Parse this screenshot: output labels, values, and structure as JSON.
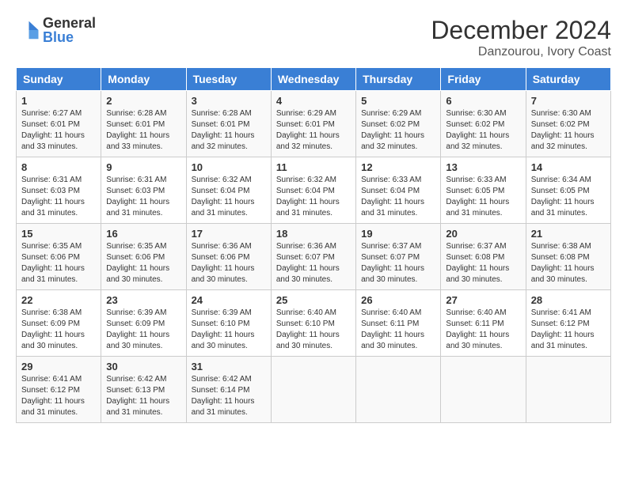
{
  "logo": {
    "general": "General",
    "blue": "Blue"
  },
  "title": "December 2024",
  "subtitle": "Danzourou, Ivory Coast",
  "days": [
    "Sunday",
    "Monday",
    "Tuesday",
    "Wednesday",
    "Thursday",
    "Friday",
    "Saturday"
  ],
  "weeks": [
    [
      {
        "day": "1",
        "sunrise": "6:27 AM",
        "sunset": "6:01 PM",
        "daylight": "11 hours and 33 minutes."
      },
      {
        "day": "2",
        "sunrise": "6:28 AM",
        "sunset": "6:01 PM",
        "daylight": "11 hours and 33 minutes."
      },
      {
        "day": "3",
        "sunrise": "6:28 AM",
        "sunset": "6:01 PM",
        "daylight": "11 hours and 32 minutes."
      },
      {
        "day": "4",
        "sunrise": "6:29 AM",
        "sunset": "6:01 PM",
        "daylight": "11 hours and 32 minutes."
      },
      {
        "day": "5",
        "sunrise": "6:29 AM",
        "sunset": "6:02 PM",
        "daylight": "11 hours and 32 minutes."
      },
      {
        "day": "6",
        "sunrise": "6:30 AM",
        "sunset": "6:02 PM",
        "daylight": "11 hours and 32 minutes."
      },
      {
        "day": "7",
        "sunrise": "6:30 AM",
        "sunset": "6:02 PM",
        "daylight": "11 hours and 32 minutes."
      }
    ],
    [
      {
        "day": "8",
        "sunrise": "6:31 AM",
        "sunset": "6:03 PM",
        "daylight": "11 hours and 31 minutes."
      },
      {
        "day": "9",
        "sunrise": "6:31 AM",
        "sunset": "6:03 PM",
        "daylight": "11 hours and 31 minutes."
      },
      {
        "day": "10",
        "sunrise": "6:32 AM",
        "sunset": "6:04 PM",
        "daylight": "11 hours and 31 minutes."
      },
      {
        "day": "11",
        "sunrise": "6:32 AM",
        "sunset": "6:04 PM",
        "daylight": "11 hours and 31 minutes."
      },
      {
        "day": "12",
        "sunrise": "6:33 AM",
        "sunset": "6:04 PM",
        "daylight": "11 hours and 31 minutes."
      },
      {
        "day": "13",
        "sunrise": "6:33 AM",
        "sunset": "6:05 PM",
        "daylight": "11 hours and 31 minutes."
      },
      {
        "day": "14",
        "sunrise": "6:34 AM",
        "sunset": "6:05 PM",
        "daylight": "11 hours and 31 minutes."
      }
    ],
    [
      {
        "day": "15",
        "sunrise": "6:35 AM",
        "sunset": "6:06 PM",
        "daylight": "11 hours and 31 minutes."
      },
      {
        "day": "16",
        "sunrise": "6:35 AM",
        "sunset": "6:06 PM",
        "daylight": "11 hours and 30 minutes."
      },
      {
        "day": "17",
        "sunrise": "6:36 AM",
        "sunset": "6:06 PM",
        "daylight": "11 hours and 30 minutes."
      },
      {
        "day": "18",
        "sunrise": "6:36 AM",
        "sunset": "6:07 PM",
        "daylight": "11 hours and 30 minutes."
      },
      {
        "day": "19",
        "sunrise": "6:37 AM",
        "sunset": "6:07 PM",
        "daylight": "11 hours and 30 minutes."
      },
      {
        "day": "20",
        "sunrise": "6:37 AM",
        "sunset": "6:08 PM",
        "daylight": "11 hours and 30 minutes."
      },
      {
        "day": "21",
        "sunrise": "6:38 AM",
        "sunset": "6:08 PM",
        "daylight": "11 hours and 30 minutes."
      }
    ],
    [
      {
        "day": "22",
        "sunrise": "6:38 AM",
        "sunset": "6:09 PM",
        "daylight": "11 hours and 30 minutes."
      },
      {
        "day": "23",
        "sunrise": "6:39 AM",
        "sunset": "6:09 PM",
        "daylight": "11 hours and 30 minutes."
      },
      {
        "day": "24",
        "sunrise": "6:39 AM",
        "sunset": "6:10 PM",
        "daylight": "11 hours and 30 minutes."
      },
      {
        "day": "25",
        "sunrise": "6:40 AM",
        "sunset": "6:10 PM",
        "daylight": "11 hours and 30 minutes."
      },
      {
        "day": "26",
        "sunrise": "6:40 AM",
        "sunset": "6:11 PM",
        "daylight": "11 hours and 30 minutes."
      },
      {
        "day": "27",
        "sunrise": "6:40 AM",
        "sunset": "6:11 PM",
        "daylight": "11 hours and 30 minutes."
      },
      {
        "day": "28",
        "sunrise": "6:41 AM",
        "sunset": "6:12 PM",
        "daylight": "11 hours and 31 minutes."
      }
    ],
    [
      {
        "day": "29",
        "sunrise": "6:41 AM",
        "sunset": "6:12 PM",
        "daylight": "11 hours and 31 minutes."
      },
      {
        "day": "30",
        "sunrise": "6:42 AM",
        "sunset": "6:13 PM",
        "daylight": "11 hours and 31 minutes."
      },
      {
        "day": "31",
        "sunrise": "6:42 AM",
        "sunset": "6:14 PM",
        "daylight": "11 hours and 31 minutes."
      },
      null,
      null,
      null,
      null
    ]
  ]
}
